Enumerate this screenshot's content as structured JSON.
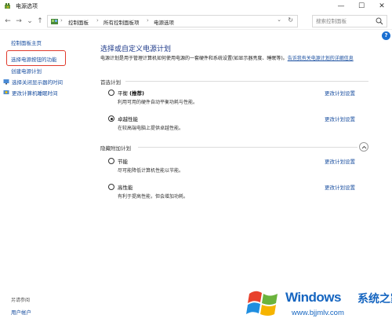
{
  "window": {
    "title": "电源选项",
    "minimize": "—",
    "maximize": "☐",
    "close": "✕"
  },
  "nav": {
    "back": "←",
    "forward": "→",
    "recent": "⌄",
    "up": "↑"
  },
  "address": {
    "crumbs": [
      "控制面板",
      "所有控制面板项",
      "电源选项"
    ],
    "separator": "›",
    "dropdown": "⌄",
    "refresh": "↻"
  },
  "search": {
    "placeholder": "搜索控制面板"
  },
  "help": "?",
  "sidebar": {
    "items": [
      {
        "label": "控制面板主页"
      },
      {
        "label": "选择电源按钮的功能"
      },
      {
        "label": "创建电源计划"
      },
      {
        "label": "选择关闭显示器的时间"
      },
      {
        "label": "更改计算机睡眠时间"
      }
    ],
    "see_also": "另请参阅",
    "user_accounts": "用户帐户"
  },
  "main": {
    "title": "选择或自定义电源计划",
    "description": "电源计划是用于管理计算机如何使用电源的一套硬件和系统设置(如显示器亮度、睡眠等)。",
    "description_link": "告诉我有关电源计划的详细信息",
    "preferred_header": "首选计划",
    "hidden_header": "隐藏附加计划",
    "plans": [
      {
        "name": "平衡",
        "suffix": "(推荐)",
        "desc": "利用可用的硬件自动平衡功耗与性能。",
        "selected": false,
        "link": "更改计划设置"
      },
      {
        "name": "卓越性能",
        "suffix": "",
        "desc": "在较高端电脑上提供卓越性能。",
        "selected": true,
        "link": "更改计划设置"
      },
      {
        "name": "节能",
        "suffix": "",
        "desc": "尽可能降低计算机性能以节能。",
        "selected": false,
        "link": "更改计划设置"
      },
      {
        "name": "高性能",
        "suffix": "",
        "desc": "有利于提高性能，但会增加功耗。",
        "selected": false,
        "link": "更改计划设置"
      }
    ]
  },
  "watermark": {
    "brand": "Windows",
    "cn": "系统之家",
    "url": "www.bjjmlv.com"
  }
}
